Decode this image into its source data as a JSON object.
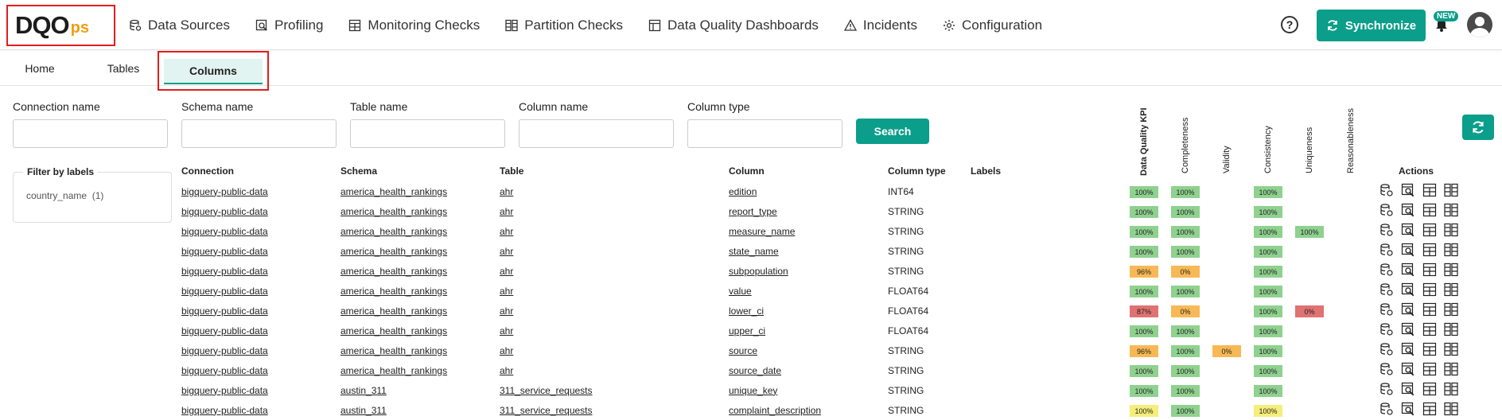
{
  "logo": {
    "main": "DQO",
    "suffix": "ps"
  },
  "nav": [
    {
      "label": "Data Sources",
      "icon": "database-icon"
    },
    {
      "label": "Profiling",
      "icon": "profiling-icon"
    },
    {
      "label": "Monitoring Checks",
      "icon": "table-icon"
    },
    {
      "label": "Partition Checks",
      "icon": "partition-icon"
    },
    {
      "label": "Data Quality Dashboards",
      "icon": "dashboard-icon"
    },
    {
      "label": "Incidents",
      "icon": "warning-icon"
    },
    {
      "label": "Configuration",
      "icon": "gear-icon"
    }
  ],
  "header": {
    "help": "?",
    "sync_label": "Synchronize",
    "new_badge": "NEW"
  },
  "tabs": {
    "home": "Home",
    "tables": "Tables",
    "columns": "Columns"
  },
  "filters": {
    "connection": "Connection name",
    "schema": "Schema name",
    "table": "Table name",
    "column": "Column name",
    "column_type": "Column type",
    "search": "Search"
  },
  "labels_filter": {
    "title": "Filter by labels",
    "item": "country_name",
    "count": "(1)"
  },
  "columns_headers": {
    "connection": "Connection",
    "schema": "Schema",
    "table": "Table",
    "column": "Column",
    "column_type": "Column type",
    "labels": "Labels",
    "actions": "Actions"
  },
  "dimension_headers": {
    "kpi": "Data Quality KPI",
    "completeness": "Completeness",
    "validity": "Validity",
    "consistency": "Consistency",
    "uniqueness": "Uniqueness",
    "reasonableness": "Reasonableness"
  },
  "colors": {
    "green": "#8fd18f",
    "orange": "#f7b955",
    "red": "#e07272",
    "yellow": "#f5ee7a",
    "accent": "#0b9e8a"
  },
  "rows": [
    {
      "connection": "bigquery-public-data",
      "schema": "america_health_rankings",
      "table": "ahr",
      "column": "edition",
      "type": "INT64",
      "kpi": {
        "v": "100%",
        "c": "green"
      },
      "completeness": {
        "v": "100%",
        "c": "green"
      },
      "validity": null,
      "consistency": {
        "v": "100%",
        "c": "green"
      },
      "uniqueness": null
    },
    {
      "connection": "bigquery-public-data",
      "schema": "america_health_rankings",
      "table": "ahr",
      "column": "report_type",
      "type": "STRING",
      "kpi": {
        "v": "100%",
        "c": "green"
      },
      "completeness": {
        "v": "100%",
        "c": "green"
      },
      "validity": null,
      "consistency": {
        "v": "100%",
        "c": "green"
      },
      "uniqueness": null
    },
    {
      "connection": "bigquery-public-data",
      "schema": "america_health_rankings",
      "table": "ahr",
      "column": "measure_name",
      "type": "STRING",
      "kpi": {
        "v": "100%",
        "c": "green"
      },
      "completeness": {
        "v": "100%",
        "c": "green"
      },
      "validity": null,
      "consistency": {
        "v": "100%",
        "c": "green"
      },
      "uniqueness": {
        "v": "100%",
        "c": "green"
      }
    },
    {
      "connection": "bigquery-public-data",
      "schema": "america_health_rankings",
      "table": "ahr",
      "column": "state_name",
      "type": "STRING",
      "kpi": {
        "v": "100%",
        "c": "green"
      },
      "completeness": {
        "v": "100%",
        "c": "green"
      },
      "validity": null,
      "consistency": {
        "v": "100%",
        "c": "green"
      },
      "uniqueness": null
    },
    {
      "connection": "bigquery-public-data",
      "schema": "america_health_rankings",
      "table": "ahr",
      "column": "subpopulation",
      "type": "STRING",
      "kpi": {
        "v": "96%",
        "c": "orange"
      },
      "completeness": {
        "v": "0%",
        "c": "orange"
      },
      "validity": null,
      "consistency": {
        "v": "100%",
        "c": "green"
      },
      "uniqueness": null
    },
    {
      "connection": "bigquery-public-data",
      "schema": "america_health_rankings",
      "table": "ahr",
      "column": "value",
      "type": "FLOAT64",
      "kpi": {
        "v": "100%",
        "c": "green"
      },
      "completeness": {
        "v": "100%",
        "c": "green"
      },
      "validity": null,
      "consistency": {
        "v": "100%",
        "c": "green"
      },
      "uniqueness": null
    },
    {
      "connection": "bigquery-public-data",
      "schema": "america_health_rankings",
      "table": "ahr",
      "column": "lower_ci",
      "type": "FLOAT64",
      "kpi": {
        "v": "87%",
        "c": "red"
      },
      "completeness": {
        "v": "0%",
        "c": "orange"
      },
      "validity": null,
      "consistency": {
        "v": "100%",
        "c": "green"
      },
      "uniqueness": {
        "v": "0%",
        "c": "red"
      }
    },
    {
      "connection": "bigquery-public-data",
      "schema": "america_health_rankings",
      "table": "ahr",
      "column": "upper_ci",
      "type": "FLOAT64",
      "kpi": {
        "v": "100%",
        "c": "green"
      },
      "completeness": {
        "v": "100%",
        "c": "green"
      },
      "validity": null,
      "consistency": {
        "v": "100%",
        "c": "green"
      },
      "uniqueness": null
    },
    {
      "connection": "bigquery-public-data",
      "schema": "america_health_rankings",
      "table": "ahr",
      "column": "source",
      "type": "STRING",
      "kpi": {
        "v": "96%",
        "c": "orange"
      },
      "completeness": {
        "v": "100%",
        "c": "green"
      },
      "validity": {
        "v": "0%",
        "c": "orange"
      },
      "consistency": {
        "v": "100%",
        "c": "green"
      },
      "uniqueness": null
    },
    {
      "connection": "bigquery-public-data",
      "schema": "america_health_rankings",
      "table": "ahr",
      "column": "source_date",
      "type": "STRING",
      "kpi": {
        "v": "100%",
        "c": "green"
      },
      "completeness": {
        "v": "100%",
        "c": "green"
      },
      "validity": null,
      "consistency": {
        "v": "100%",
        "c": "green"
      },
      "uniqueness": null
    },
    {
      "connection": "bigquery-public-data",
      "schema": "austin_311",
      "table": "311_service_requests",
      "column": "unique_key",
      "type": "STRING",
      "kpi": {
        "v": "100%",
        "c": "green"
      },
      "completeness": {
        "v": "100%",
        "c": "green"
      },
      "validity": null,
      "consistency": {
        "v": "100%",
        "c": "green"
      },
      "uniqueness": null
    },
    {
      "connection": "bigquery-public-data",
      "schema": "austin_311",
      "table": "311_service_requests",
      "column": "complaint_description",
      "type": "STRING",
      "kpi": {
        "v": "100%",
        "c": "yellow"
      },
      "completeness": {
        "v": "100%",
        "c": "green"
      },
      "validity": null,
      "consistency": {
        "v": "100%",
        "c": "yellow"
      },
      "uniqueness": null
    }
  ]
}
